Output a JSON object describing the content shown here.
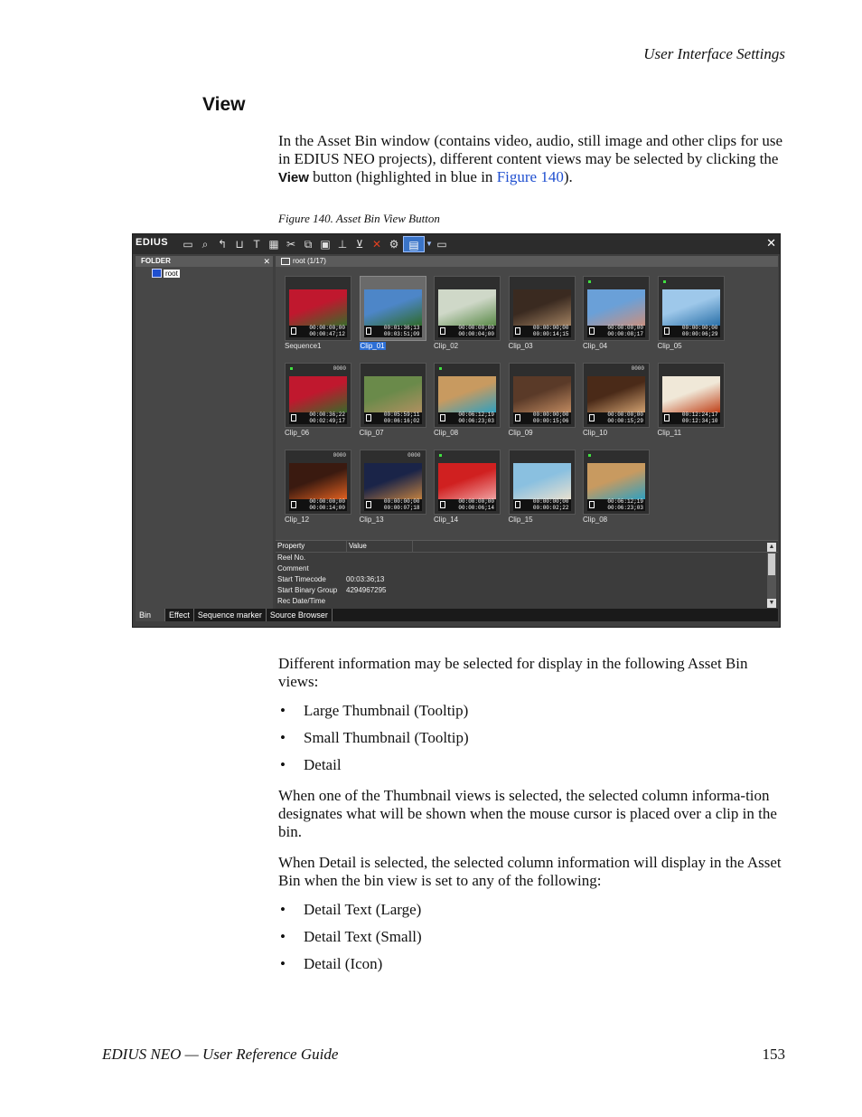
{
  "running_head": "User Interface Settings",
  "section_title": "View",
  "intro": {
    "part1": "In the Asset Bin window (contains video, audio, still image and other clips for use in EDIUS NEO projects), different content views may be selected by clicking the ",
    "keyword": "View",
    "part2": " button (highlighted in blue in ",
    "link": "Figure 140",
    "part3": ")."
  },
  "figure_caption": "Figure 140.  Asset Bin View Button",
  "app": {
    "title": "EDIUS",
    "folder_header": "FOLDER",
    "folder_root": "root",
    "bin_header": "root (1/17)",
    "clips": [
      {
        "name": "Sequence1",
        "tc1": "00:00:00;00",
        "tc2": "00:00:47;12",
        "marker": false,
        "counter": "",
        "colors": [
          "#c0182e",
          "#3a6a2a"
        ],
        "seq": true
      },
      {
        "name": "Clip_01",
        "tc1": "00:01:36;13",
        "tc2": "00:03:51;09",
        "marker": false,
        "counter": "",
        "colors": [
          "#4d86c8",
          "#2f6a2a"
        ],
        "selected": true
      },
      {
        "name": "Clip_02",
        "tc1": "00:00:00;00",
        "tc2": "00:00:04;00",
        "marker": false,
        "counter": "",
        "colors": [
          "#cfd8c8",
          "#5a8a48"
        ]
      },
      {
        "name": "Clip_03",
        "tc1": "00:00:00;00",
        "tc2": "00:00:14;15",
        "marker": false,
        "counter": "",
        "colors": [
          "#3a2a20",
          "#a08060"
        ]
      },
      {
        "name": "Clip_04",
        "tc1": "00:00:00;00",
        "tc2": "00:00:08;17",
        "marker": true,
        "counter": "",
        "colors": [
          "#6aa0d8",
          "#c89080"
        ]
      },
      {
        "name": "Clip_05",
        "tc1": "00:00:00;00",
        "tc2": "00:00:06;29",
        "marker": true,
        "counter": "",
        "colors": [
          "#9ec8ea",
          "#2a70a8"
        ]
      },
      {
        "name": "Clip_06",
        "tc1": "00:00:36;22",
        "tc2": "00:02:49;17",
        "marker": true,
        "counter": "0000",
        "colors": [
          "#c0182e",
          "#3a6a2a"
        ]
      },
      {
        "name": "Clip_07",
        "tc1": "00:05:59;11",
        "tc2": "00:06:16;02",
        "marker": false,
        "counter": "",
        "colors": [
          "#6a8a4a",
          "#b09060"
        ]
      },
      {
        "name": "Clip_08",
        "tc1": "00:06:12;19",
        "tc2": "00:06:23;03",
        "marker": true,
        "counter": "",
        "colors": [
          "#c89a60",
          "#30a0c0"
        ]
      },
      {
        "name": "Clip_09",
        "tc1": "00:00:00;00",
        "tc2": "00:00:15;06",
        "marker": false,
        "counter": "",
        "colors": [
          "#5a3a28",
          "#c08a60"
        ]
      },
      {
        "name": "Clip_10",
        "tc1": "00:00:00;00",
        "tc2": "00:00:15;29",
        "marker": false,
        "counter": "0000",
        "colors": [
          "#4a2a18",
          "#d0a070"
        ]
      },
      {
        "name": "Clip_11",
        "tc1": "00:12:24;17",
        "tc2": "00:12:34;10",
        "marker": false,
        "counter": "",
        "colors": [
          "#f0e8d8",
          "#c04018"
        ]
      },
      {
        "name": "Clip_12",
        "tc1": "00:00:00;00",
        "tc2": "00:00:14;00",
        "marker": false,
        "counter": "0000",
        "colors": [
          "#3a1a10",
          "#e06020"
        ]
      },
      {
        "name": "Clip_13",
        "tc1": "00:00:00;00",
        "tc2": "00:00:07;18",
        "marker": false,
        "counter": "0000",
        "colors": [
          "#1a2448",
          "#c08040"
        ]
      },
      {
        "name": "Clip_14",
        "tc1": "00:00:00;00",
        "tc2": "00:00:06;14",
        "marker": true,
        "counter": "",
        "colors": [
          "#d02020",
          "#f0a0a0"
        ]
      },
      {
        "name": "Clip_15",
        "tc1": "00:00:00;00",
        "tc2": "00:00:02;22",
        "marker": false,
        "counter": "",
        "colors": [
          "#8ac0e0",
          "#e8e0d0"
        ]
      },
      {
        "name": "Clip_08",
        "tc1": "00:06:12;19",
        "tc2": "00:06:23;03",
        "marker": true,
        "counter": "",
        "colors": [
          "#c89a60",
          "#30a0c0"
        ]
      }
    ],
    "props_header": {
      "property": "Property",
      "value": "Value"
    },
    "props": [
      {
        "property": "Reel No.",
        "value": ""
      },
      {
        "property": "Comment",
        "value": ""
      },
      {
        "property": "Start Timecode",
        "value": "00:03:36;13"
      },
      {
        "property": "Start Binary Group",
        "value": "4294967295"
      },
      {
        "property": "Rec Date/Time",
        "value": ""
      }
    ],
    "tabs": [
      "Bin",
      "Effect",
      "Sequence marker",
      "Source Browser"
    ]
  },
  "para2": "Different information may be selected for display in the following Asset Bin views:",
  "views": [
    "Large Thumbnail (Tooltip)",
    "Small Thumbnail (Tooltip)",
    "Detail"
  ],
  "para3": "When one of the Thumbnail views is selected, the selected column informa-tion designates what will be shown when the mouse cursor is placed over a clip in the bin.",
  "para4": "When Detail is selected, the selected column information will display in the Asset Bin when the bin view is set to any of the following:",
  "detail_views": [
    "Detail Text (Large)",
    "Detail Text (Small)",
    "Detail (Icon)"
  ],
  "footer": {
    "left": "EDIUS NEO  —  User Reference Guide",
    "page": "153"
  }
}
